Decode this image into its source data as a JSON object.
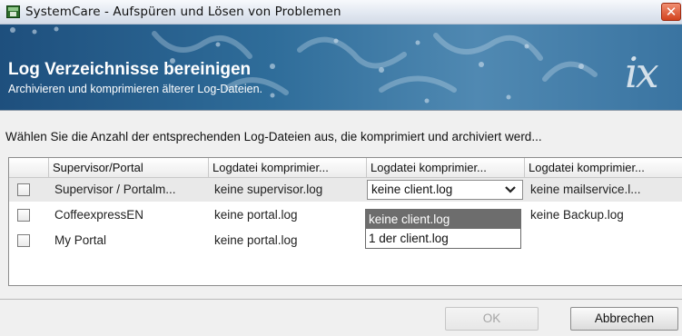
{
  "window": {
    "title": "SystemCare - Aufspüren und Lösen von Problemen",
    "close_glyph": "✕",
    "app_icon": "systemcare-app-icon"
  },
  "banner": {
    "title": "Log Verzeichnisse bereinigen",
    "subtitle": "Archivieren und komprimieren älterer Log-Dateien.",
    "logo_text": "ix",
    "background_color": "#2f6d9a"
  },
  "instruction": "Wählen Sie die Anzahl der entsprechenden Log-Dateien aus, die komprimiert und archiviert werd...",
  "table": {
    "headers": [
      "Supervisor/Portal",
      "Logdatei komprimier...",
      "Logdatei komprimier...",
      "Logdatei komprimier..."
    ],
    "rows": [
      {
        "checked": false,
        "name": "Supervisor / Portalm...",
        "col2": "keine supervisor.log",
        "col3": "keine client.log",
        "col4": "keine mailservice.l..."
      },
      {
        "checked": false,
        "name": "CoffeexpressEN",
        "col2": "keine portal.log",
        "col3": "",
        "col4": "keine Backup.log"
      },
      {
        "checked": false,
        "name": "My Portal",
        "col2": "keine portal.log",
        "col3": "",
        "col4": ""
      }
    ]
  },
  "dropdown": {
    "selected": "keine client.log",
    "options": [
      "keine client.log",
      "1 der client.log"
    ],
    "highlight_color": "#6d6d6d"
  },
  "buttons": {
    "ok": "OK",
    "cancel": "Abbrechen"
  }
}
